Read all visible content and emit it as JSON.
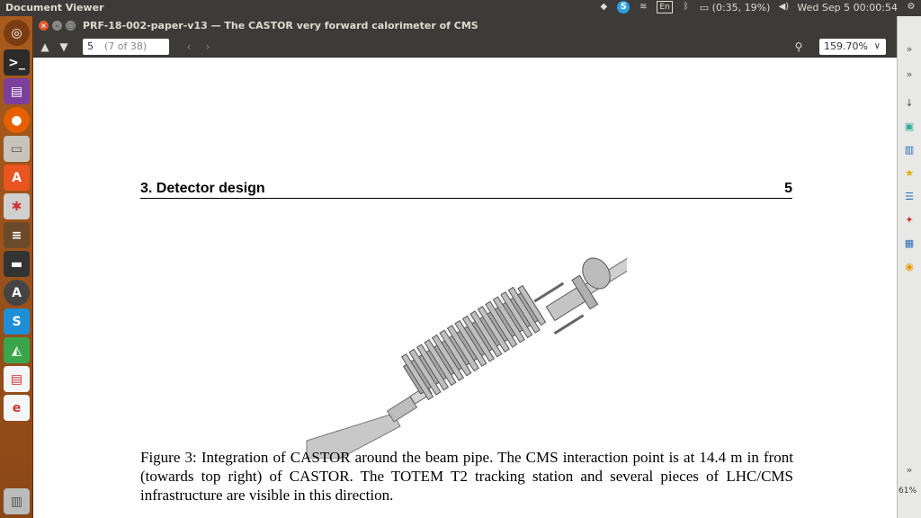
{
  "topbar": {
    "app_name": "Document Viewer",
    "keyboard_layout": "En",
    "battery": "(0:35, 19%)",
    "datetime": "Wed Sep  5 00:00:54"
  },
  "window": {
    "title": "PRF-18-002-paper-v13 — The CASTOR very forward calorimeter of CMS"
  },
  "toolbar": {
    "page_value": "5",
    "page_count": "(7 of 38)",
    "zoom": "159.70%"
  },
  "document": {
    "section_title": "3.  Detector design",
    "page_number": "5",
    "caption": "Figure 3: Integration of CASTOR around the beam pipe. The CMS interaction point is at 14.4 m in front (towards top right) of CASTOR. The TOTEM T2 tracking station and several pieces of LHC/CMS infrastructure are visible in this direction."
  },
  "right_panel": {
    "zoom_percent": "61%"
  }
}
